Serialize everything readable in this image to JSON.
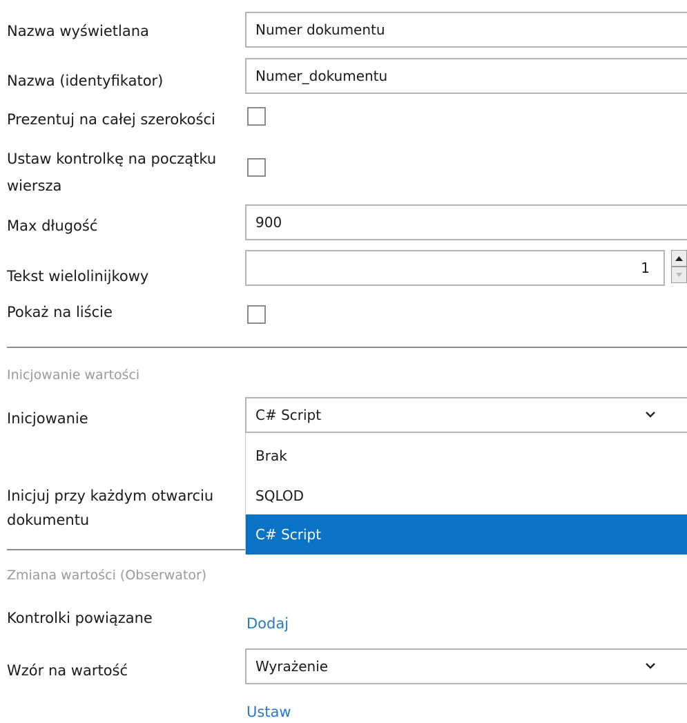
{
  "fields": {
    "display_name": {
      "label": "Nazwa wyświetlana",
      "value": "Numer dokumentu"
    },
    "identifier": {
      "label": "Nazwa (identyfikator)",
      "value": "Numer_dokumentu"
    },
    "full_width": {
      "label": "Prezentuj na całej szerokości",
      "checked": false
    },
    "row_start": {
      "label_line1": "Ustaw kontrolkę na początku",
      "label_line2": "wiersza",
      "checked": false
    },
    "max_length": {
      "label": "Max długość",
      "value": "900"
    },
    "multiline": {
      "label": "Tekst wielolinijkowy",
      "value": "1"
    },
    "show_on_list": {
      "label": "Pokaż na liście",
      "checked": false
    }
  },
  "init_section": {
    "title": "Inicjowanie wartości",
    "init": {
      "label": "Inicjowanie",
      "value": "C# Script"
    },
    "init_each_open": {
      "label_line1": "Inicjuj przy każdym otwarciu",
      "label_line2": "dokumentu"
    },
    "dropdown_options": [
      "Brak",
      "SQLOD",
      "C# Script"
    ],
    "selected_option": "C# Script"
  },
  "observer_section": {
    "title": "Zmiana wartości (Obserwator)",
    "related_controls": {
      "label": "Kontrolki powiązane",
      "link": "Dodaj"
    },
    "value_formula": {
      "label": "Wzór na wartość",
      "value": "Wyrażenie",
      "link": "Ustaw"
    }
  },
  "colors": {
    "accent": "#0a73c6",
    "link": "#2b79c5",
    "section_title": "#9a9a9a"
  }
}
